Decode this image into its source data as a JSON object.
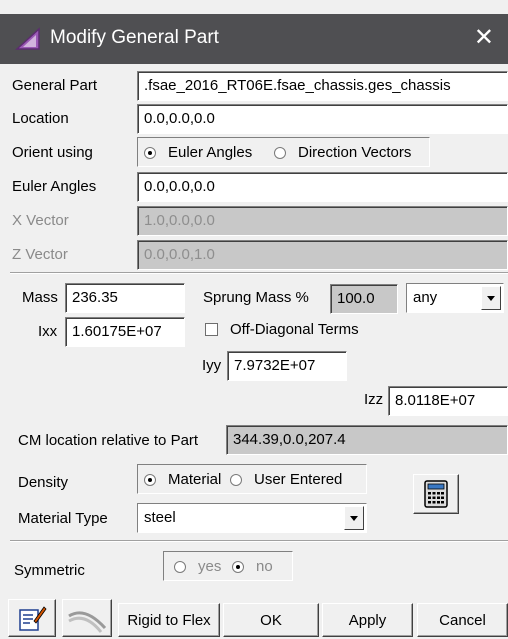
{
  "window": {
    "title": "Modify General Part",
    "close_glyph": "✕",
    "title_icon": "adams-triangle-icon",
    "accent": "#4f4f52"
  },
  "general_part": {
    "label": "General Part",
    "value": ".fsae_2016_RT06E.fsae_chassis.ges_chassis"
  },
  "location": {
    "label": "Location",
    "value": "0.0,0.0,0.0"
  },
  "orient_using": {
    "label": "Orient using",
    "options": [
      "Euler Angles",
      "Direction Vectors"
    ],
    "selected": "Euler Angles"
  },
  "euler_angles": {
    "label": "Euler Angles",
    "value": "0.0,0.0,0.0"
  },
  "x_vector": {
    "label": "X Vector",
    "value": "1.0,0.0,0.0",
    "enabled": false
  },
  "z_vector": {
    "label": "Z Vector",
    "value": "0.0,0.0,1.0",
    "enabled": false
  },
  "mass": {
    "label": "Mass",
    "value": "236.35"
  },
  "sprung_mass": {
    "label": "Sprung Mass %",
    "value": "100.0",
    "mode": "any"
  },
  "ixx": {
    "label": "Ixx",
    "value": "1.60175E+07"
  },
  "off_diagonal": {
    "label": "Off-Diagonal Terms",
    "checked": false
  },
  "iyy": {
    "label": "Iyy",
    "value": "7.9732E+07"
  },
  "izz": {
    "label": "Izz",
    "value": "8.0118E+07"
  },
  "cm_location": {
    "label": "CM location relative to Part",
    "value": "344.39,0.0,207.4"
  },
  "density": {
    "label": "Density",
    "options": [
      "Material",
      "User Entered"
    ],
    "selected": "Material"
  },
  "material_type": {
    "label": "Material Type",
    "value": "steel"
  },
  "symmetric": {
    "label": "Symmetric",
    "options": [
      "yes",
      "no"
    ],
    "selected": "no",
    "enabled": false
  },
  "buttons": {
    "rigid_to_flex": "Rigid to Flex",
    "ok": "OK",
    "apply": "Apply",
    "cancel": "Cancel"
  }
}
